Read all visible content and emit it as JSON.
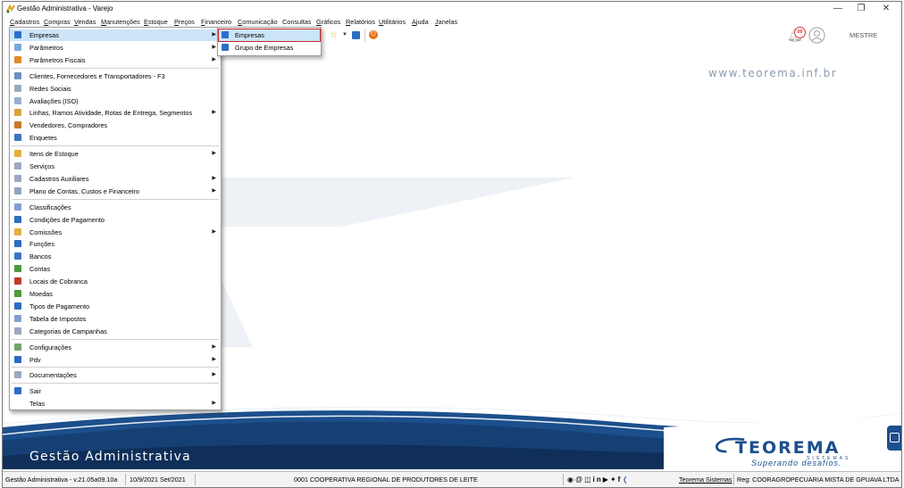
{
  "window": {
    "title": "Gestão Administrativa - Varejo",
    "controls": {
      "minimize": "—",
      "restore": "❐",
      "close": "✕"
    }
  },
  "menubar": [
    "Cadastros",
    "Compras",
    "Vendas",
    "Manutenções",
    "Estoque",
    "Preços",
    "Financeiro",
    "Comunicação",
    "Consultas",
    "Gráficos",
    "Relatórios",
    "Utilitários",
    "Ajuda",
    "Janelas"
  ],
  "toolbar": {
    "notification_count": "00",
    "user_label": "MESTRE"
  },
  "cadastros_menu": [
    {
      "label": "Empresas",
      "submenu": true,
      "icon": "folder-icon",
      "color": "#2a6fc9",
      "highlight": true
    },
    {
      "label": "Parâmetros",
      "submenu": true,
      "icon": "params-icon",
      "color": "#7aa7d9"
    },
    {
      "label": "Parâmetros Fiscais",
      "submenu": true,
      "icon": "fiscal-icon",
      "color": "#e08a2a"
    },
    {
      "sep": true
    },
    {
      "label": "Clientes, Fornecedores e Transportadores - F3",
      "icon": "people-icon",
      "color": "#6b8fc4"
    },
    {
      "label": "Redes Sociais",
      "icon": "network-icon",
      "color": "#9aa9c0"
    },
    {
      "label": "Avaliações (ISO)",
      "icon": "rating-icon",
      "color": "#9ab0cc"
    },
    {
      "label": "Linhas, Ramos Atividade, Rotas de Entrega, Segmentos",
      "submenu": true,
      "icon": "tree-icon",
      "color": "#d9a43a"
    },
    {
      "label": "Vendedores, Compradores",
      "icon": "salesperson-icon",
      "color": "#c9782b"
    },
    {
      "label": "Enquetes",
      "icon": "poll-icon",
      "color": "#3d74c4"
    },
    {
      "sep": true
    },
    {
      "label": "Itens de Estoque",
      "submenu": true,
      "icon": "stock-icon",
      "color": "#e3b23c"
    },
    {
      "label": "Serviços",
      "icon": "services-icon",
      "color": "#9aa9c0"
    },
    {
      "label": "Cadastros Auxiliares",
      "submenu": true,
      "icon": "auxiliary-icon",
      "color": "#9aa9c0"
    },
    {
      "label": "Plano de Contas, Custos e Financeiro",
      "submenu": true,
      "icon": "accounts-icon",
      "color": "#8da4c6"
    },
    {
      "sep": true
    },
    {
      "label": "Classificações",
      "icon": "classification-icon",
      "color": "#7ea1d1"
    },
    {
      "label": "Condições de Pagamento",
      "icon": "payment-conditions-icon",
      "color": "#2f6cc2"
    },
    {
      "label": "Comissões",
      "submenu": true,
      "icon": "commission-icon",
      "color": "#e3b23c"
    },
    {
      "label": "Funções",
      "icon": "functions-icon",
      "color": "#2f6cc2"
    },
    {
      "label": "Bancos",
      "icon": "bank-icon",
      "color": "#3d74c4"
    },
    {
      "label": "Contas",
      "icon": "accounts-money-icon",
      "color": "#4a9a3a"
    },
    {
      "label": "Locais de Cobranca",
      "icon": "billing-places-icon",
      "color": "#c0392b"
    },
    {
      "label": "Moedas",
      "icon": "currency-icon",
      "color": "#4a9a3a"
    },
    {
      "label": "Tipos de Pagamento",
      "icon": "payment-types-icon",
      "color": "#2f6cc2"
    },
    {
      "label": "Tabela de Impostos",
      "icon": "tax-table-icon",
      "color": "#7ea1d1"
    },
    {
      "label": "Categorias de Campanhas",
      "icon": "campaign-icon",
      "color": "#9aa9c0"
    },
    {
      "sep": true
    },
    {
      "label": "Configurações",
      "submenu": true,
      "icon": "settings-icon",
      "color": "#6ea56a"
    },
    {
      "label": "Pdv",
      "submenu": true,
      "icon": "pdv-icon",
      "color": "#2f6cc2"
    },
    {
      "sep": true
    },
    {
      "label": "Documentações",
      "submenu": true,
      "icon": "docs-icon",
      "color": "#9aa9c0"
    },
    {
      "sep": true
    },
    {
      "label": "Sair",
      "icon": "exit-icon",
      "color": "#2f6cc2"
    },
    {
      "label": "Telas",
      "submenu": true,
      "icon": "",
      "color": ""
    }
  ],
  "empresas_submenu": [
    {
      "label": "Empresas",
      "highlight": true
    },
    {
      "label": "Grupo de Empresas"
    }
  ],
  "workspace": {
    "url_text": "www.teorema.inf.br",
    "banner_text": "Gestão Administrativa",
    "logo_text": "TEOREMA",
    "logo_sub": "SISTEMAS",
    "logo_tagline": "Superando desafios."
  },
  "statusbar": {
    "version": "Gestão Administrativa - v.21.05a09.10a",
    "date": "10/9/2021 Set/2021",
    "company": "0001 COOPERATIVA REGIONAL DE PRODUTORES DE LEITE",
    "link": "Teorema Sistemas",
    "registration": "Reg: COORAGROPECUARIA MISTA DE GPUAVA LTDA"
  },
  "colors": {
    "accent_blue": "#1c4f8c",
    "highlight": "#cce4f7",
    "red_outline": "#c62828",
    "banner_blue": "#163f74"
  }
}
